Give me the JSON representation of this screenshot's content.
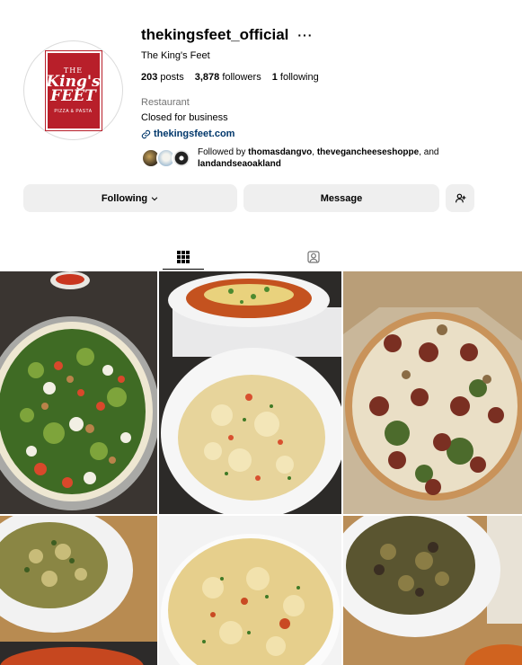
{
  "profile": {
    "username": "thekingsfeet_official",
    "more_label": "···",
    "full_name": "The King's Feet",
    "stats": {
      "posts_count": "203",
      "posts_label": "posts",
      "followers_count": "3,878",
      "followers_label": "followers",
      "following_count": "1",
      "following_label": "following"
    },
    "category": "Restaurant",
    "bio": "Closed for business",
    "link": "thekingsfeet.com",
    "followed_by_prefix": "Followed by ",
    "followed_by_users": [
      "thomasdangvo",
      "theveganchee​seshoppe",
      "landandseaoakland"
    ],
    "followed_by_sep": ", ",
    "followed_by_and": ", and ",
    "logo": {
      "line1": "THE",
      "line2": "King's",
      "line3": "FEET",
      "line4": "PIZZA & PASTA"
    }
  },
  "actions": {
    "following_label": "Following",
    "message_label": "Message"
  },
  "tabs": [
    {
      "icon": "grid-icon",
      "active": true
    },
    {
      "icon": "tagged-icon",
      "active": false
    }
  ],
  "posts": [
    {
      "subject": "spinach-pizza"
    },
    {
      "subject": "baked-pasta-and-mac"
    },
    {
      "subject": "sausage-pizza"
    },
    {
      "subject": "pesto-pasta"
    },
    {
      "subject": "mac-and-cheese"
    },
    {
      "subject": "mushroom-pasta"
    }
  ],
  "colors": {
    "link": "#00376b",
    "button_bg": "#efefef",
    "logo_red": "#b81f2a"
  }
}
